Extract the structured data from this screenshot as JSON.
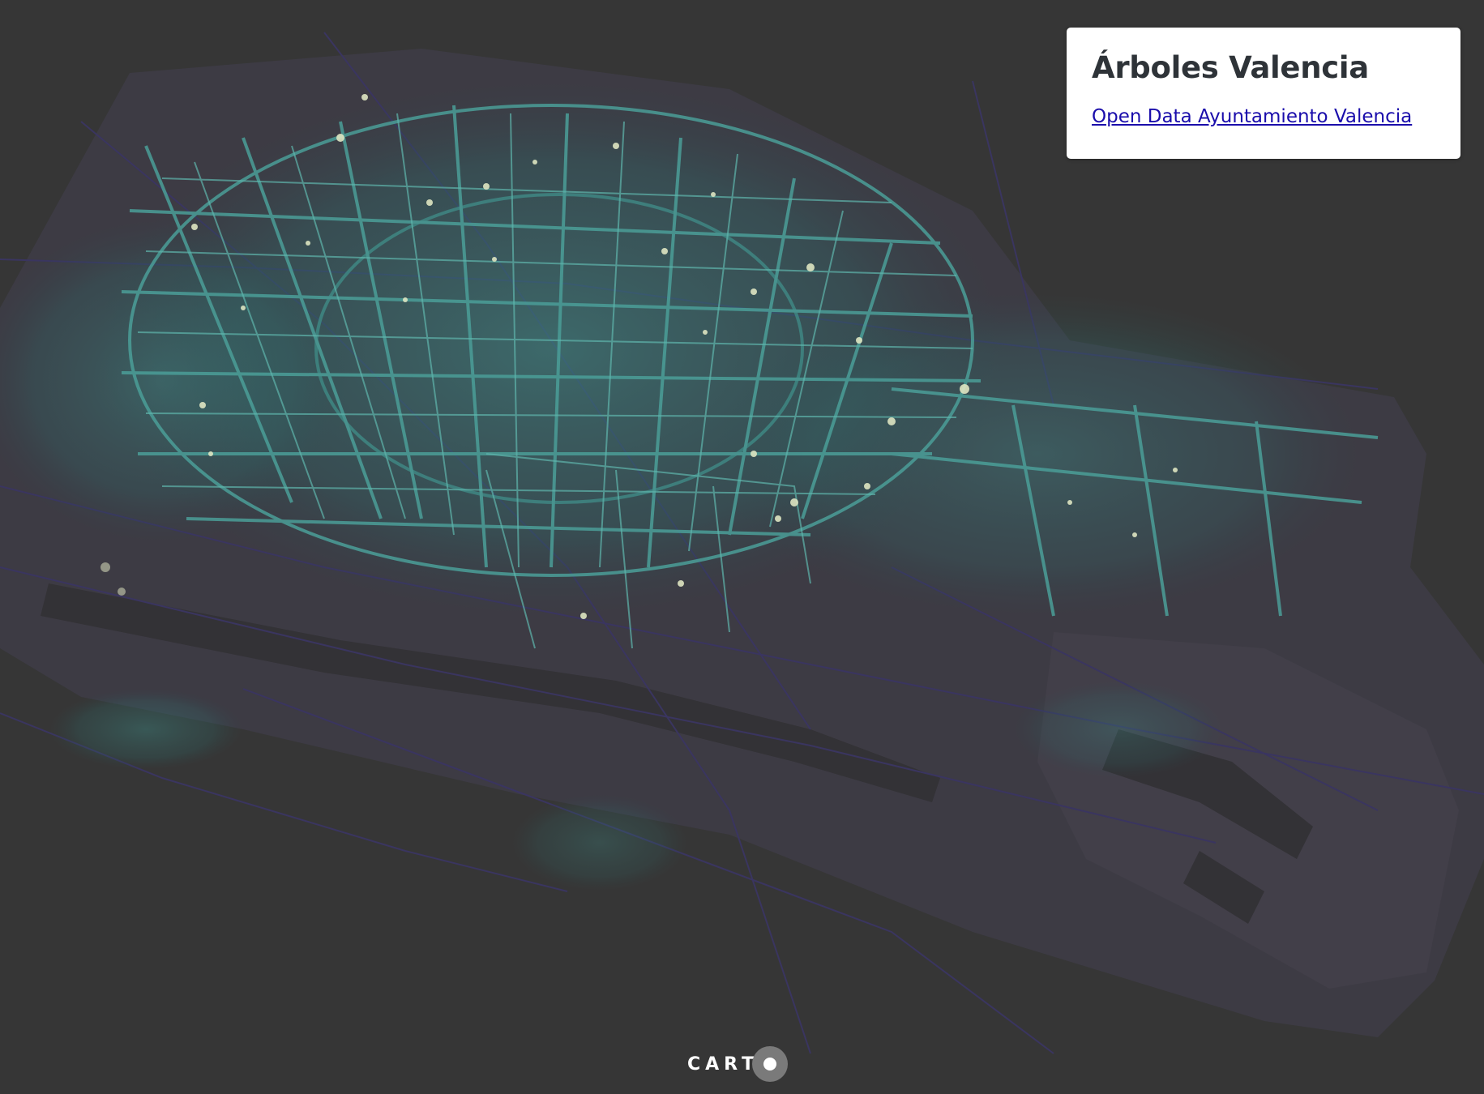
{
  "panel": {
    "title": "Árboles Valencia",
    "link_text": "Open Data Ayuntamiento Valencia"
  },
  "attribution": {
    "logo_text": "CART"
  },
  "colors": {
    "background": "#363636",
    "land": "#3d3b44",
    "roads": "#3a3560",
    "tree_low": "#2a5e63",
    "tree_mid": "#4fa39c",
    "tree_high": "#e6e9c8"
  },
  "icons": {
    "carto_logo": "carto-logo-icon"
  }
}
